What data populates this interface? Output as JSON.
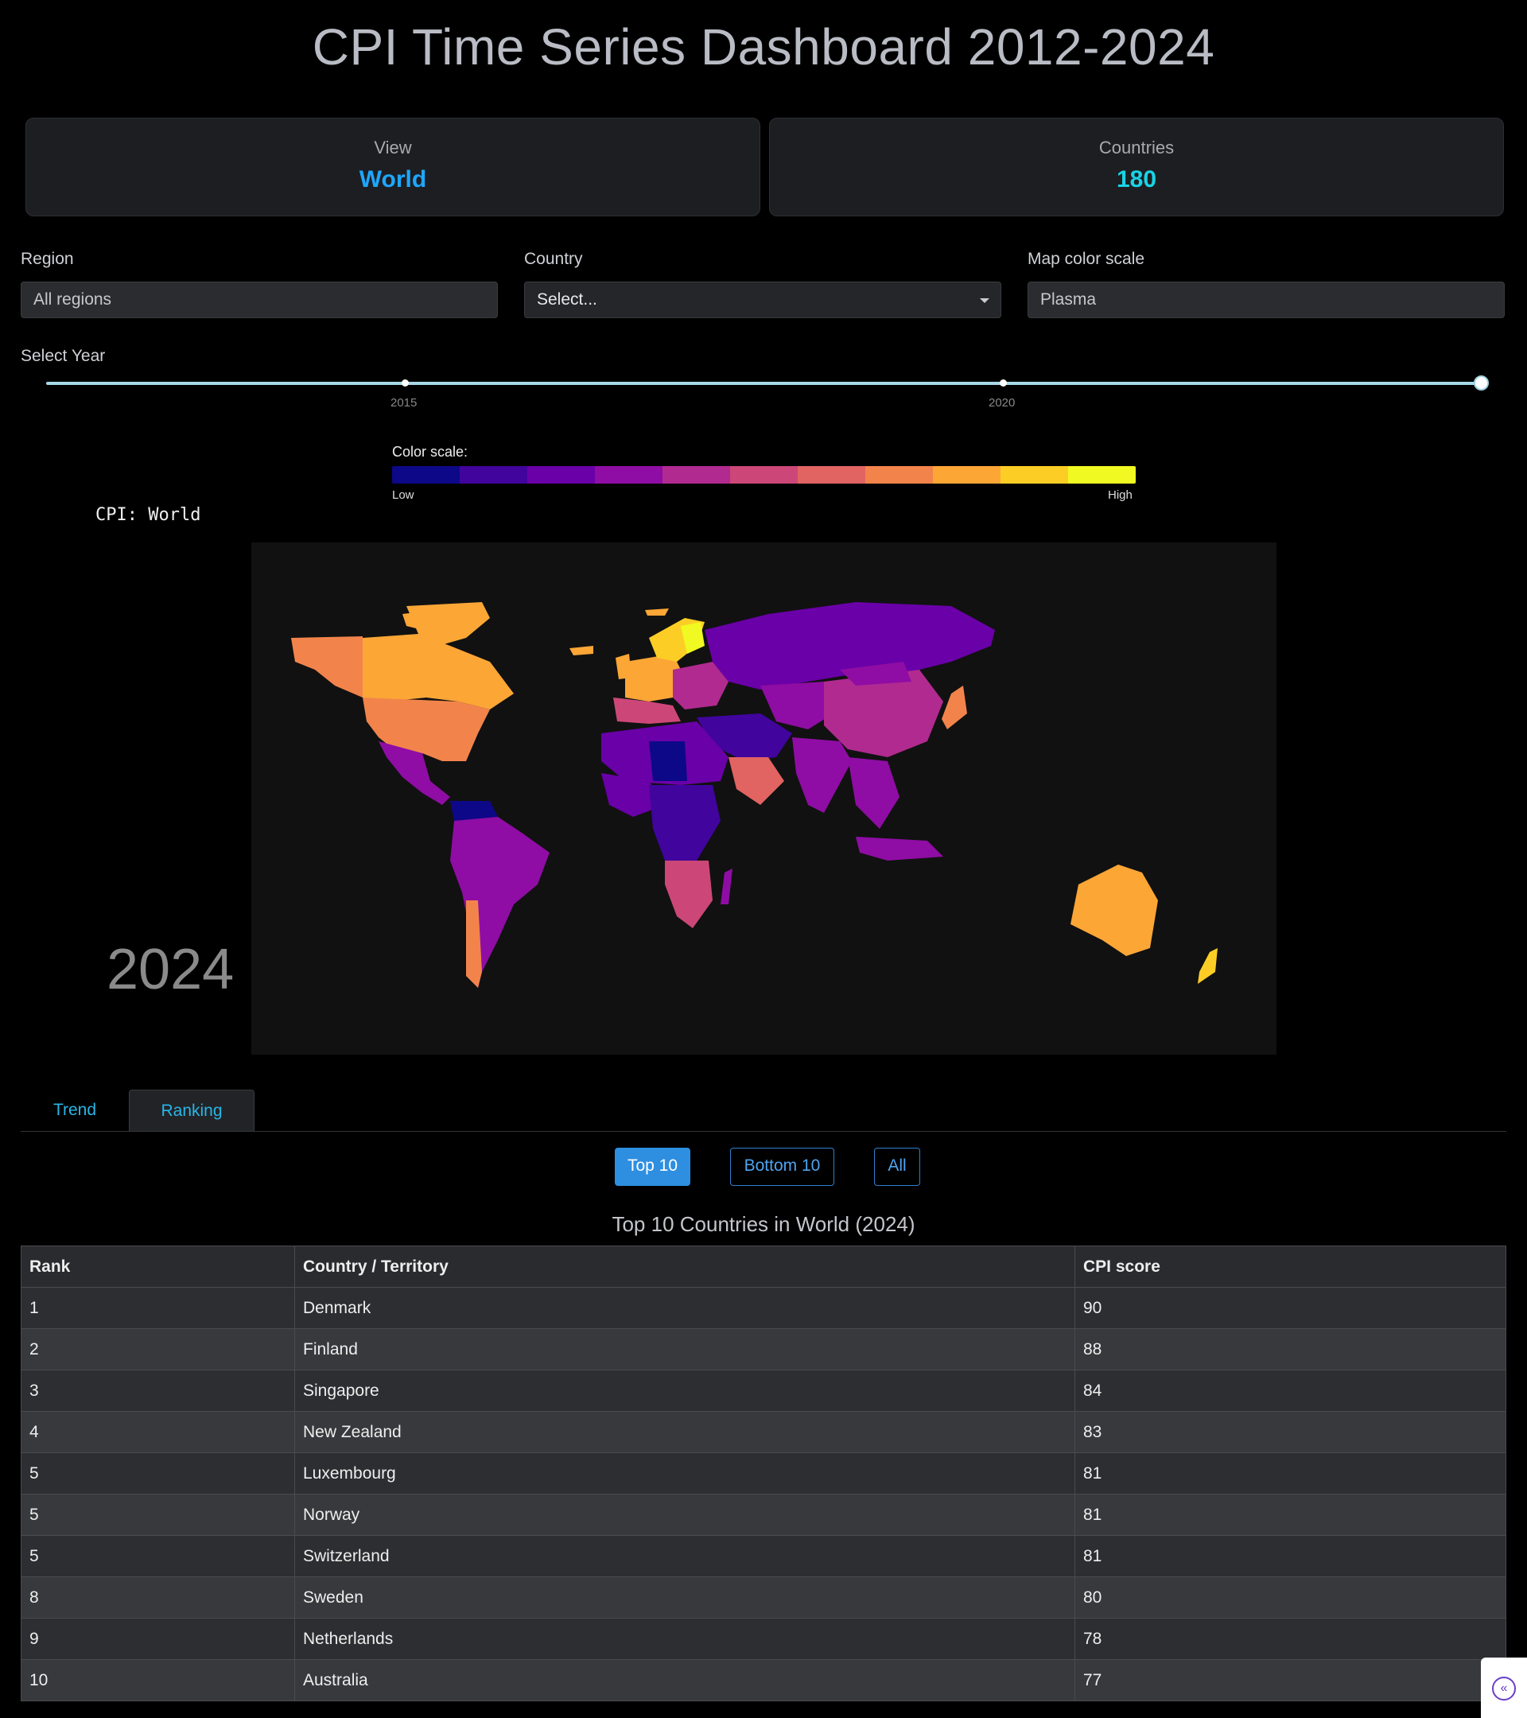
{
  "title": "CPI Time Series Dashboard 2012-2024",
  "cards": [
    {
      "label": "View",
      "value": "World",
      "color": "#1ea7ff"
    },
    {
      "label": "Countries",
      "value": "180",
      "color": "#19d3e6"
    }
  ],
  "controls": {
    "region": {
      "label": "Region",
      "value": "All regions"
    },
    "country": {
      "label": "Country",
      "placeholder": "Select..."
    },
    "colorscale": {
      "label": "Map color scale",
      "value": "Plasma"
    }
  },
  "year_slider": {
    "label": "Select Year",
    "ticks": [
      "2015",
      "2020"
    ],
    "min": 2012,
    "max": 2024,
    "value": 2024
  },
  "color_legend": {
    "label": "Color scale:",
    "low": "Low",
    "high": "High",
    "colors": [
      "#0d0887",
      "#41049d",
      "#6a00a8",
      "#8f0da4",
      "#b12a90",
      "#cc4778",
      "#e16462",
      "#f2844b",
      "#fca636",
      "#fcce25",
      "#f0f921"
    ]
  },
  "map": {
    "title": "CPI: World",
    "year_label": "2024"
  },
  "tabs": [
    {
      "label": "Trend",
      "active": false
    },
    {
      "label": "Ranking",
      "active": true
    }
  ],
  "filter_buttons": [
    {
      "label": "Top 10",
      "active": true
    },
    {
      "label": "Bottom 10",
      "active": false
    },
    {
      "label": "All",
      "active": false
    }
  ],
  "ranking": {
    "title": "Top 10 Countries in World (2024)",
    "columns": [
      "Rank",
      "Country / Territory",
      "CPI score"
    ],
    "rows": [
      [
        "1",
        "Denmark",
        "90"
      ],
      [
        "2",
        "Finland",
        "88"
      ],
      [
        "3",
        "Singapore",
        "84"
      ],
      [
        "4",
        "New Zealand",
        "83"
      ],
      [
        "5",
        "Luxembourg",
        "81"
      ],
      [
        "5",
        "Norway",
        "81"
      ],
      [
        "5",
        "Switzerland",
        "81"
      ],
      [
        "8",
        "Sweden",
        "80"
      ],
      [
        "9",
        "Netherlands",
        "78"
      ],
      [
        "10",
        "Australia",
        "77"
      ]
    ]
  }
}
